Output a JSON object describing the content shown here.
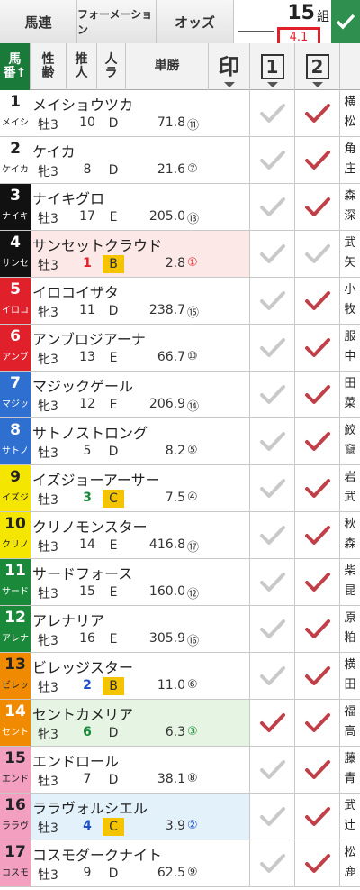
{
  "tabs": {
    "umaren": "馬連",
    "formation": "フォーメーション",
    "odds": "オッズ"
  },
  "combo": {
    "count": "15",
    "unit": "組",
    "odds": "4.1"
  },
  "header": {
    "uma_l1": "馬",
    "uma_l2": "番↑",
    "sex_l1": "性",
    "sex_l2": "齢",
    "sui_l1": "推",
    "sui_l2": "人",
    "ninki_l1": "人",
    "ninki_l2": "ラ",
    "tansho": "単勝",
    "mark": "印",
    "col1": "1",
    "col2": "2"
  },
  "colors": {
    "checked": "#c0404a",
    "unchecked": "#c9c9c9",
    "confirm": "#2f8f4f"
  },
  "horses": [
    {
      "num": "1",
      "abbr": "メイシ",
      "name": "メイショウツカ",
      "sex": "牡3",
      "pop": "10",
      "rank": "D",
      "odds": "71.8",
      "pidx": "⑪",
      "c1": false,
      "c2": true,
      "jockey": [
        "横",
        "松"
      ],
      "bg": "#ffffff",
      "fg": "#222222"
    },
    {
      "num": "2",
      "abbr": "ケイカ",
      "name": "ケイカ",
      "sex": "牝3",
      "pop": "8",
      "rank": "D",
      "odds": "21.6",
      "pidx": "⑦",
      "c1": false,
      "c2": true,
      "jockey": [
        "角",
        "庄"
      ],
      "bg": "#ffffff",
      "fg": "#222222"
    },
    {
      "num": "3",
      "abbr": "ナイキ",
      "name": "ナイキグロ",
      "sex": "牡3",
      "pop": "17",
      "rank": "E",
      "odds": "205.0",
      "pidx": "⑬",
      "c1": false,
      "c2": true,
      "jockey": [
        "森",
        "深"
      ],
      "bg": "#111111",
      "fg": "#ffffff"
    },
    {
      "num": "4",
      "abbr": "サンセ",
      "name": "サンセットクラウド",
      "sex": "牡3",
      "pop": "1",
      "rank": "B",
      "odds": "2.8",
      "pidx": "①",
      "c1": false,
      "c2": false,
      "jockey": [
        "武",
        "矢"
      ],
      "bg": "#111111",
      "fg": "#ffffff",
      "fav": "1"
    },
    {
      "num": "5",
      "abbr": "イロコ",
      "name": "イロコイザタ",
      "sex": "牝3",
      "pop": "11",
      "rank": "D",
      "odds": "238.7",
      "pidx": "⑮",
      "c1": false,
      "c2": true,
      "jockey": [
        "小",
        "牧"
      ],
      "bg": "#e0202a",
      "fg": "#ffffff"
    },
    {
      "num": "6",
      "abbr": "アンブ",
      "name": "アンブロジアーナ",
      "sex": "牝3",
      "pop": "13",
      "rank": "E",
      "odds": "66.7",
      "pidx": "⑩",
      "c1": false,
      "c2": true,
      "jockey": [
        "服",
        "中"
      ],
      "bg": "#e0202a",
      "fg": "#ffffff"
    },
    {
      "num": "7",
      "abbr": "マジッ",
      "name": "マジックゲール",
      "sex": "牝3",
      "pop": "12",
      "rank": "E",
      "odds": "206.9",
      "pidx": "⑭",
      "c1": false,
      "c2": true,
      "jockey": [
        "田",
        "菜"
      ],
      "bg": "#2f6fd0",
      "fg": "#ffffff"
    },
    {
      "num": "8",
      "abbr": "サトノ",
      "name": "サトノストロング",
      "sex": "牡3",
      "pop": "5",
      "rank": "D",
      "odds": "8.2",
      "pidx": "⑤",
      "c1": false,
      "c2": true,
      "jockey": [
        "鮫",
        "竄"
      ],
      "bg": "#2f6fd0",
      "fg": "#ffffff"
    },
    {
      "num": "9",
      "abbr": "イズジ",
      "name": "イズジョーアーサー",
      "sex": "牡3",
      "pop": "3",
      "rank": "C",
      "odds": "7.5",
      "pidx": "④",
      "c1": false,
      "c2": true,
      "jockey": [
        "岩",
        "武"
      ],
      "bg": "#f5e600",
      "fg": "#222222"
    },
    {
      "num": "10",
      "abbr": "クリノ",
      "name": "クリノモンスター",
      "sex": "牡3",
      "pop": "14",
      "rank": "E",
      "odds": "416.8",
      "pidx": "⑰",
      "c1": false,
      "c2": true,
      "jockey": [
        "秋",
        "森"
      ],
      "bg": "#f5e600",
      "fg": "#222222"
    },
    {
      "num": "11",
      "abbr": "サード",
      "name": "サードフォース",
      "sex": "牡3",
      "pop": "15",
      "rank": "E",
      "odds": "160.0",
      "pidx": "⑫",
      "c1": false,
      "c2": true,
      "jockey": [
        "柴",
        "昆"
      ],
      "bg": "#1a8a3a",
      "fg": "#ffffff"
    },
    {
      "num": "12",
      "abbr": "アレナ",
      "name": "アレナリア",
      "sex": "牝3",
      "pop": "16",
      "rank": "E",
      "odds": "305.9",
      "pidx": "⑯",
      "c1": false,
      "c2": true,
      "jockey": [
        "原",
        "粕"
      ],
      "bg": "#1a8a3a",
      "fg": "#ffffff"
    },
    {
      "num": "13",
      "abbr": "ビレッ",
      "name": "ビレッジスター",
      "sex": "牡3",
      "pop": "2",
      "rank": "B",
      "odds": "11.0",
      "pidx": "⑥",
      "c1": false,
      "c2": true,
      "jockey": [
        "横",
        "田"
      ],
      "bg": "#f08a00",
      "fg": "#222222"
    },
    {
      "num": "14",
      "abbr": "セント",
      "name": "セントカメリア",
      "sex": "牝3",
      "pop": "6",
      "rank": "D",
      "odds": "6.3",
      "pidx": "③",
      "c1": true,
      "c2": true,
      "jockey": [
        "福",
        "高"
      ],
      "bg": "#f08a00",
      "fg": "#ffffff",
      "fav": "3"
    },
    {
      "num": "15",
      "abbr": "エンド",
      "name": "エンドロール",
      "sex": "牡3",
      "pop": "7",
      "rank": "D",
      "odds": "38.1",
      "pidx": "⑧",
      "c1": false,
      "c2": true,
      "jockey": [
        "藤",
        "青"
      ],
      "bg": "#f3a0c0",
      "fg": "#222222"
    },
    {
      "num": "16",
      "abbr": "ララヴ",
      "name": "ララヴォルシエル",
      "sex": "牡3",
      "pop": "4",
      "rank": "C",
      "odds": "3.9",
      "pidx": "②",
      "c1": false,
      "c2": true,
      "jockey": [
        "武",
        "辻"
      ],
      "bg": "#f3a0c0",
      "fg": "#222222",
      "fav": "2"
    },
    {
      "num": "17",
      "abbr": "コスモ",
      "name": "コスモダークナイト",
      "sex": "牡3",
      "pop": "9",
      "rank": "D",
      "odds": "62.5",
      "pidx": "⑨",
      "c1": false,
      "c2": true,
      "jockey": [
        "松",
        "鹿"
      ],
      "bg": "#f3a0c0",
      "fg": "#222222"
    }
  ]
}
